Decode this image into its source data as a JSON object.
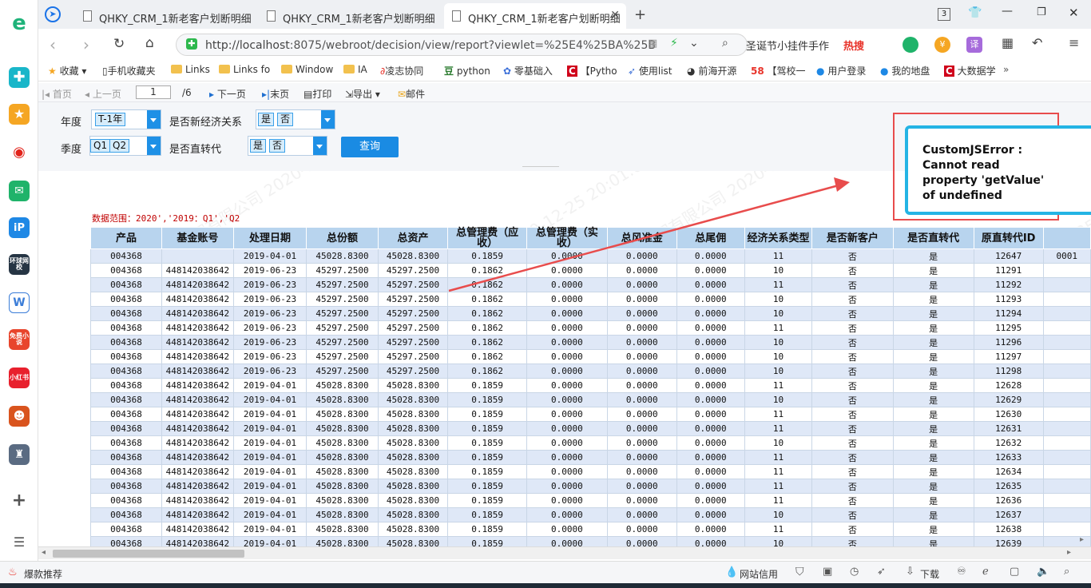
{
  "browser": {
    "tabs": [
      {
        "title": "QHKY_CRM_1新老客户划断明细"
      },
      {
        "title": "QHKY_CRM_1新老客户划断明细"
      },
      {
        "title": "QHKY_CRM_1新老客户划断明细"
      }
    ],
    "tab_count_badge": "3",
    "url_host": "http://localhost",
    "url_rest": ":8075/webroot/decision/view/report?viewlet=%25E4%25BA%25B",
    "search_text": "圣诞节小挂件手作",
    "search_hot": "热搜"
  },
  "bookmarks": [
    {
      "label": "收藏"
    },
    {
      "label": "手机收藏夹"
    },
    {
      "label": "Links"
    },
    {
      "label": "Links fo"
    },
    {
      "label": "Window"
    },
    {
      "label": "IA"
    },
    {
      "label": "凌志协同"
    },
    {
      "label": "python"
    },
    {
      "label": "零基础入"
    },
    {
      "label": "【Pytho"
    },
    {
      "label": "使用list"
    },
    {
      "label": "前海开源"
    },
    {
      "label": "【驾校一"
    },
    {
      "label": "用户登录"
    },
    {
      "label": "我的地盘"
    },
    {
      "label": "大数据学"
    }
  ],
  "toolbar": {
    "first": "首页",
    "prev": "上一页",
    "page": "1",
    "total": "/6",
    "next": "下一页",
    "last": "末页",
    "print": "打印",
    "export": "导出",
    "mail": "邮件"
  },
  "params": {
    "year_label": "年度",
    "year_value": "T-1年",
    "newrel_label": "是否新经济关系",
    "newrel_opts": [
      "是",
      "否"
    ],
    "quarter_label": "季度",
    "quarter_opts": [
      "Q1",
      "Q2"
    ],
    "direct_label": "是否直转代",
    "direct_opts": [
      "是",
      "否"
    ],
    "query_label": "查询"
  },
  "report": {
    "data_range": "数据范围：2020','2019：Q1','Q2",
    "watermark": "前海开源基金管理有限公司 2020-12-25 20:01:01",
    "headers": [
      "产品",
      "基金账号",
      "处理日期",
      "总份额",
      "总资产",
      "总管理费（应收）",
      "总管理费（实收）",
      "总风准金",
      "总尾佣",
      "经济关系类型",
      "是否新客户",
      "是否直转代",
      "原直转代ID",
      ""
    ],
    "rows": [
      [
        "004368",
        "",
        "2019-04-01",
        "45028.8300",
        "45028.8300",
        "0.1859",
        "0.0000",
        "0.0000",
        "0.0000",
        "11",
        "否",
        "是",
        "12647",
        "0001"
      ],
      [
        "004368",
        "448142038642",
        "2019-06-23",
        "45297.2500",
        "45297.2500",
        "0.1862",
        "0.0000",
        "0.0000",
        "0.0000",
        "10",
        "否",
        "是",
        "11291",
        ""
      ],
      [
        "004368",
        "448142038642",
        "2019-06-23",
        "45297.2500",
        "45297.2500",
        "0.1862",
        "0.0000",
        "0.0000",
        "0.0000",
        "11",
        "否",
        "是",
        "11292",
        ""
      ],
      [
        "004368",
        "448142038642",
        "2019-06-23",
        "45297.2500",
        "45297.2500",
        "0.1862",
        "0.0000",
        "0.0000",
        "0.0000",
        "10",
        "否",
        "是",
        "11293",
        ""
      ],
      [
        "004368",
        "448142038642",
        "2019-06-23",
        "45297.2500",
        "45297.2500",
        "0.1862",
        "0.0000",
        "0.0000",
        "0.0000",
        "10",
        "否",
        "是",
        "11294",
        ""
      ],
      [
        "004368",
        "448142038642",
        "2019-06-23",
        "45297.2500",
        "45297.2500",
        "0.1862",
        "0.0000",
        "0.0000",
        "0.0000",
        "11",
        "否",
        "是",
        "11295",
        ""
      ],
      [
        "004368",
        "448142038642",
        "2019-06-23",
        "45297.2500",
        "45297.2500",
        "0.1862",
        "0.0000",
        "0.0000",
        "0.0000",
        "10",
        "否",
        "是",
        "11296",
        ""
      ],
      [
        "004368",
        "448142038642",
        "2019-06-23",
        "45297.2500",
        "45297.2500",
        "0.1862",
        "0.0000",
        "0.0000",
        "0.0000",
        "10",
        "否",
        "是",
        "11297",
        ""
      ],
      [
        "004368",
        "448142038642",
        "2019-06-23",
        "45297.2500",
        "45297.2500",
        "0.1862",
        "0.0000",
        "0.0000",
        "0.0000",
        "10",
        "否",
        "是",
        "11298",
        ""
      ],
      [
        "004368",
        "448142038642",
        "2019-04-01",
        "45028.8300",
        "45028.8300",
        "0.1859",
        "0.0000",
        "0.0000",
        "0.0000",
        "11",
        "否",
        "是",
        "12628",
        ""
      ],
      [
        "004368",
        "448142038642",
        "2019-04-01",
        "45028.8300",
        "45028.8300",
        "0.1859",
        "0.0000",
        "0.0000",
        "0.0000",
        "10",
        "否",
        "是",
        "12629",
        ""
      ],
      [
        "004368",
        "448142038642",
        "2019-04-01",
        "45028.8300",
        "45028.8300",
        "0.1859",
        "0.0000",
        "0.0000",
        "0.0000",
        "11",
        "否",
        "是",
        "12630",
        ""
      ],
      [
        "004368",
        "448142038642",
        "2019-04-01",
        "45028.8300",
        "45028.8300",
        "0.1859",
        "0.0000",
        "0.0000",
        "0.0000",
        "11",
        "否",
        "是",
        "12631",
        ""
      ],
      [
        "004368",
        "448142038642",
        "2019-04-01",
        "45028.8300",
        "45028.8300",
        "0.1859",
        "0.0000",
        "0.0000",
        "0.0000",
        "10",
        "否",
        "是",
        "12632",
        ""
      ],
      [
        "004368",
        "448142038642",
        "2019-04-01",
        "45028.8300",
        "45028.8300",
        "0.1859",
        "0.0000",
        "0.0000",
        "0.0000",
        "11",
        "否",
        "是",
        "12633",
        ""
      ],
      [
        "004368",
        "448142038642",
        "2019-04-01",
        "45028.8300",
        "45028.8300",
        "0.1859",
        "0.0000",
        "0.0000",
        "0.0000",
        "11",
        "否",
        "是",
        "12634",
        ""
      ],
      [
        "004368",
        "448142038642",
        "2019-04-01",
        "45028.8300",
        "45028.8300",
        "0.1859",
        "0.0000",
        "0.0000",
        "0.0000",
        "11",
        "否",
        "是",
        "12635",
        ""
      ],
      [
        "004368",
        "448142038642",
        "2019-04-01",
        "45028.8300",
        "45028.8300",
        "0.1859",
        "0.0000",
        "0.0000",
        "0.0000",
        "11",
        "否",
        "是",
        "12636",
        ""
      ],
      [
        "004368",
        "448142038642",
        "2019-04-01",
        "45028.8300",
        "45028.8300",
        "0.1859",
        "0.0000",
        "0.0000",
        "0.0000",
        "10",
        "否",
        "是",
        "12637",
        ""
      ],
      [
        "004368",
        "448142038642",
        "2019-04-01",
        "45028.8300",
        "45028.8300",
        "0.1859",
        "0.0000",
        "0.0000",
        "0.0000",
        "11",
        "否",
        "是",
        "12638",
        ""
      ],
      [
        "004368",
        "448142038642",
        "2019-04-01",
        "45028.8300",
        "45028.8300",
        "0.1859",
        "0.0000",
        "0.0000",
        "0.0000",
        "10",
        "否",
        "是",
        "12639",
        ""
      ]
    ]
  },
  "error": {
    "message": "CustomJSError : Cannot read property 'getValue' of undefined",
    "accent": "#24b4e4",
    "arrow_color": "#e84c4c"
  },
  "sidebar": [
    {
      "icon": "browser-logo-icon"
    },
    {
      "icon": "plus-app-icon"
    },
    {
      "icon": "star-app-icon"
    },
    {
      "icon": "weibo-icon"
    },
    {
      "icon": "mail-icon"
    },
    {
      "icon": "ip-app-icon"
    },
    {
      "label": "环球网校"
    },
    {
      "icon": "doc-icon"
    },
    {
      "label": "免费小说"
    },
    {
      "label": "小红书"
    },
    {
      "icon": "game-icon"
    },
    {
      "icon": "game2-icon"
    }
  ],
  "status": {
    "left": "爆款推荐",
    "credit": "网站信用",
    "download": "下载"
  }
}
